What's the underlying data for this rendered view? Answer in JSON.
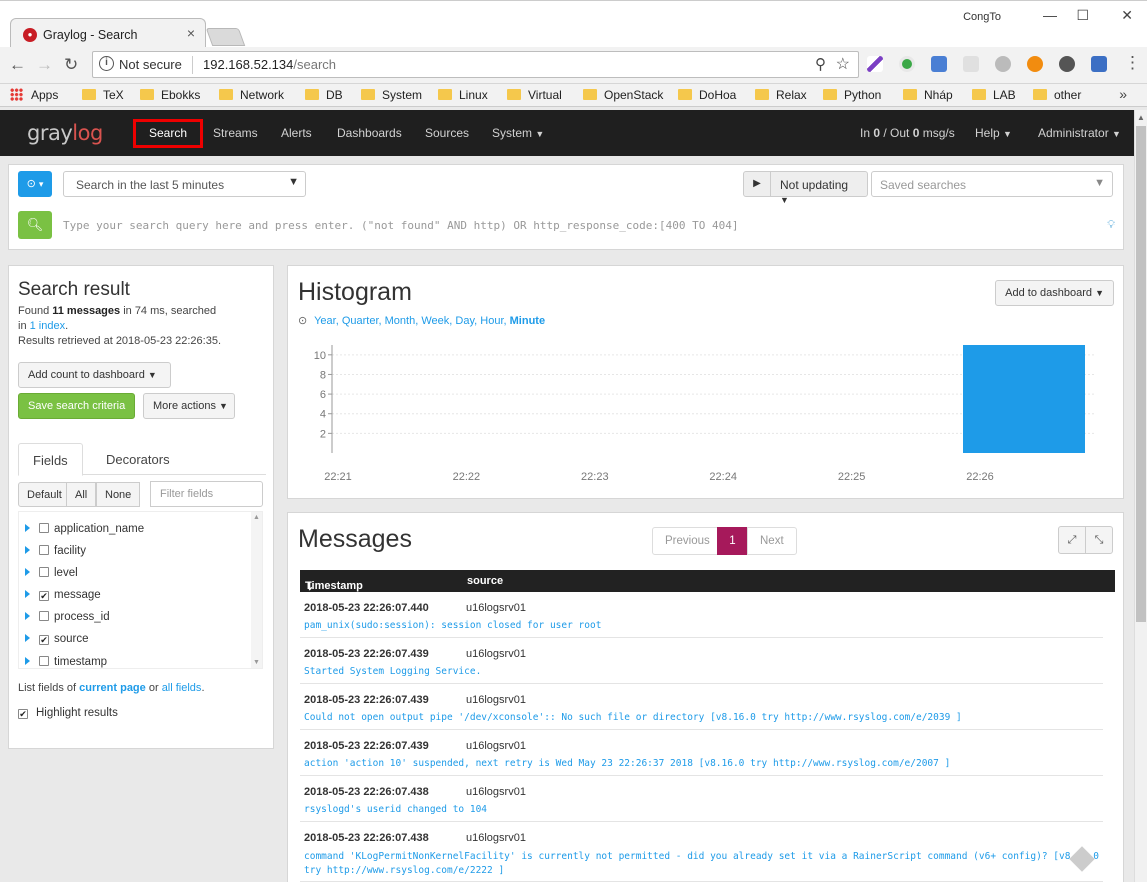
{
  "browser": {
    "tab_title": "Graylog - Search",
    "window_user": "CongTo",
    "omnibox": {
      "security": "Not secure",
      "host": "192.168.52.134",
      "path": "/search"
    },
    "bookmarks": [
      "Apps",
      "TeX",
      "Ebokks",
      "Network",
      "DB",
      "System",
      "Linux",
      "Virtual",
      "OpenStack",
      "DoHoa",
      "Relax",
      "Python",
      "Nháp",
      "LAB",
      "other"
    ],
    "bookmarks_more": "»"
  },
  "nav": {
    "logo_main": "gray",
    "logo_accent": "log",
    "items": [
      "Search",
      "Streams",
      "Alerts",
      "Dashboards",
      "Sources",
      "System"
    ],
    "throughput_prefix": "In ",
    "throughput_in": "0",
    "throughput_mid": " / Out ",
    "throughput_out": "0",
    "throughput_suffix": " msg/s",
    "help": "Help",
    "user": "Administrator"
  },
  "searchbar": {
    "range_label": "Search in the last 5 minutes",
    "updating": "Not updating",
    "saved_placeholder": "Saved searches",
    "query_placeholder": "Type your search query here and press enter. (\"not found\" AND http) OR http_response_code:[400 TO 404]"
  },
  "result": {
    "title": "Search result",
    "found_prefix": "Found ",
    "found_count": "11 messages",
    "found_suffix": " in 74 ms, searched",
    "in_prefix": "in ",
    "index_link": "1 index",
    "retrieved": "Results retrieved at 2018-05-23 22:26:35.",
    "add_count": "Add count to dashboard",
    "save_criteria": "Save search criteria",
    "more_actions": "More actions",
    "tabs": [
      "Fields",
      "Decorators"
    ],
    "filter_buttons": [
      "Default",
      "All",
      "None"
    ],
    "filter_placeholder": "Filter fields",
    "fields": [
      {
        "name": "application_name",
        "checked": false
      },
      {
        "name": "facility",
        "checked": false
      },
      {
        "name": "level",
        "checked": false
      },
      {
        "name": "message",
        "checked": true
      },
      {
        "name": "process_id",
        "checked": false
      },
      {
        "name": "source",
        "checked": true
      },
      {
        "name": "timestamp",
        "checked": false
      }
    ],
    "list_prefix": "List fields of ",
    "current_page": "current page",
    "list_or": " or ",
    "all_fields": "all fields",
    "list_end": ".",
    "highlight": "Highlight results"
  },
  "histogram": {
    "title": "Histogram",
    "add_to_dashboard": "Add to dashboard",
    "resolutions": [
      "Year",
      "Quarter",
      "Month",
      "Week",
      "Day",
      "Hour",
      "Minute"
    ],
    "active_resolution": "Minute"
  },
  "chart_data": {
    "type": "bar",
    "title": "",
    "xlabel": "",
    "ylabel": "",
    "categories": [
      "22:21",
      "22:22",
      "22:23",
      "22:24",
      "22:25",
      "22:26"
    ],
    "values": [
      0,
      0,
      0,
      0,
      0,
      11
    ],
    "yticks": [
      2,
      4,
      6,
      8,
      10
    ],
    "ylim": [
      0,
      11
    ],
    "grid": true,
    "bar_color": "#1e9be8"
  },
  "messages": {
    "title": "Messages",
    "pager": [
      "Previous",
      "1",
      "Next"
    ],
    "columns": [
      "Timestamp",
      "source"
    ],
    "rows": [
      {
        "ts": "2018-05-23 22:26:07.440",
        "source": "u16logsrv01",
        "msg": "pam_unix(sudo:session): session closed for user root"
      },
      {
        "ts": "2018-05-23 22:26:07.439",
        "source": "u16logsrv01",
        "msg": "Started System Logging Service."
      },
      {
        "ts": "2018-05-23 22:26:07.439",
        "source": "u16logsrv01",
        "msg": "Could not open output pipe '/dev/xconsole':: No such file or directory [v8.16.0 try http://www.rsyslog.com/e/2039 ]"
      },
      {
        "ts": "2018-05-23 22:26:07.439",
        "source": "u16logsrv01",
        "msg": "action 'action 10' suspended, next retry is Wed May 23 22:26:37 2018 [v8.16.0 try http://www.rsyslog.com/e/2007 ]"
      },
      {
        "ts": "2018-05-23 22:26:07.438",
        "source": "u16logsrv01",
        "msg": "rsyslogd's userid changed to 104"
      },
      {
        "ts": "2018-05-23 22:26:07.438",
        "source": "u16logsrv01",
        "msg": "command 'KLogPermitNonKernelFacility' is currently not permitted - did you already set it via a RainerScript command (v6+ config)? [v8.16.0 try http://www.rsyslog.com/e/2222 ]"
      }
    ]
  }
}
